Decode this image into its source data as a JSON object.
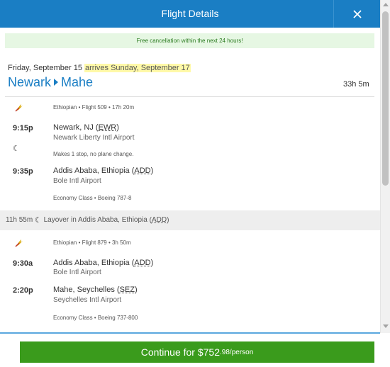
{
  "header": {
    "title": "Flight Details",
    "close_label": "✕"
  },
  "notice": "Free cancellation within the next 24 hours!",
  "trip": {
    "depart_date": "Friday, September 15",
    "arrives_note": "arrives Sunday, September 17",
    "origin": "Newark",
    "destination": "Mahe",
    "duration": "33h 5m"
  },
  "segments": [
    {
      "airline_info": "Ethiopian • Flight 509 • 17h 20m",
      "depart_time": "9:15p",
      "depart_city": "Newark, NJ",
      "depart_code": "EWR",
      "depart_airport": "Newark Liberty Intl Airport",
      "stop_note": "Makes 1 stop, no plane change.",
      "arrive_time": "9:35p",
      "arrive_city": "Addis Ababa, Ethiopia",
      "arrive_code": "ADD",
      "arrive_airport": "Bole Intl Airport",
      "cabin": "Economy Class • Boeing 787-8"
    },
    {
      "airline_info": "Ethiopian • Flight 879 • 3h 50m",
      "depart_time": "9:30a",
      "depart_city": "Addis Ababa, Ethiopia",
      "depart_code": "ADD",
      "depart_airport": "Bole Intl Airport",
      "arrive_time": "2:20p",
      "arrive_city": "Mahe, Seychelles",
      "arrive_code": "SEZ",
      "arrive_airport": "Seychelles Intl Airport",
      "cabin": "Economy Class • Boeing 737-800"
    }
  ],
  "layover": {
    "duration": "11h 55m",
    "text": "Layover in Addis Ababa, Ethiopia",
    "code": "ADD"
  },
  "footer": {
    "continue_label": "Continue for $752",
    "price_suffix": ".98/person"
  },
  "colors": {
    "brand": "#1a7ec4",
    "cta": "#3a9b1c",
    "notice_bg": "#e6f7e3",
    "highlight": "#fff9a8"
  },
  "icons": {
    "airline": "ethiopian-airline-logo-icon",
    "overnight": "moon-icon",
    "close": "close-icon"
  }
}
